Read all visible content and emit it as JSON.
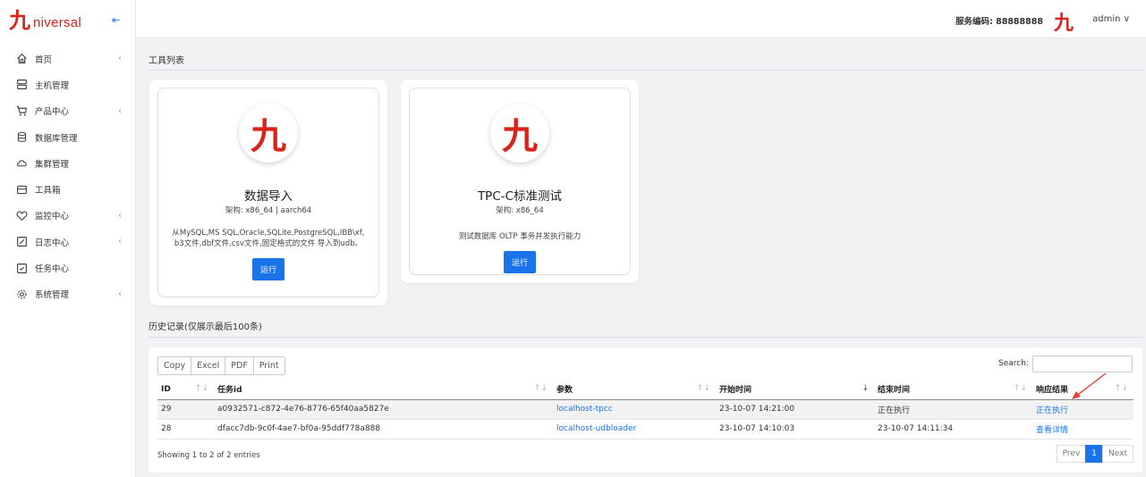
{
  "brand": {
    "logo": "九",
    "name": "niversal"
  },
  "sidebar": {
    "items": [
      {
        "label": "首页",
        "icon": "home-icon",
        "has_sub": true
      },
      {
        "label": "主机管理",
        "icon": "server-icon",
        "has_sub": false
      },
      {
        "label": "产品中心",
        "icon": "cart-icon",
        "has_sub": true
      },
      {
        "label": "数据库管理",
        "icon": "database-icon",
        "has_sub": false
      },
      {
        "label": "集群管理",
        "icon": "cloud-icon",
        "has_sub": false
      },
      {
        "label": "工具箱",
        "icon": "toolbox-icon",
        "has_sub": false
      },
      {
        "label": "监控中心",
        "icon": "heart-icon",
        "has_sub": true
      },
      {
        "label": "日志中心",
        "icon": "edit-icon",
        "has_sub": true
      },
      {
        "label": "任务中心",
        "icon": "clipboard-check-icon",
        "has_sub": false
      },
      {
        "label": "系统管理",
        "icon": "gear-icon",
        "has_sub": true
      }
    ]
  },
  "header": {
    "service_code": "服务编码: 88888888",
    "logo": "九",
    "user": "admin"
  },
  "tools": {
    "title": "工具列表",
    "cards": [
      {
        "logo": "九",
        "title": "数据导入",
        "arch": "架构: x86_64 | aarch64",
        "desc": "从MySQL,MS SQL,Oracle,SQLite,PostgreSQL,IBB\\xf,b3文件,dbf文件,csv文件,固定格式的文件 导入到udb。",
        "run": "运行"
      },
      {
        "logo": "九",
        "title": "TPC-C标准测试",
        "arch": "架构: x86_64",
        "desc": "测试数据库 OLTP 事务并发执行能力",
        "run": "运行"
      }
    ]
  },
  "history": {
    "title": "历史记录(仅展示最后100条)",
    "buttons": [
      "Copy",
      "Excel",
      "PDF",
      "Print"
    ],
    "search_label": "Search:",
    "columns": [
      "ID",
      "任务id",
      "参数",
      "开始时间",
      "结束时间",
      "响应结果"
    ],
    "rows": [
      {
        "id": "29",
        "task_id": "a0932571-c872-4e76-8776-65f40aa5827e",
        "param": "localhost-tpcc",
        "start": "23-10-07 14:21:00",
        "end": "正在执行",
        "result": "正在执行"
      },
      {
        "id": "28",
        "task_id": "dfacc7db-9c0f-4ae7-bf0a-95ddf778a888",
        "param": "localhost-udbloader",
        "start": "23-10-07 14:10:03",
        "end": "23-10-07 14:11:34",
        "result": "查看详情"
      }
    ],
    "showing": "Showing 1 to 2 of 2 entries",
    "pager": {
      "prev": "Prev",
      "current": "1",
      "next": "Next"
    }
  },
  "colors": {
    "accent": "#1a73e8",
    "brand": "#d9231b",
    "annotation_arrow": "#e53935"
  }
}
